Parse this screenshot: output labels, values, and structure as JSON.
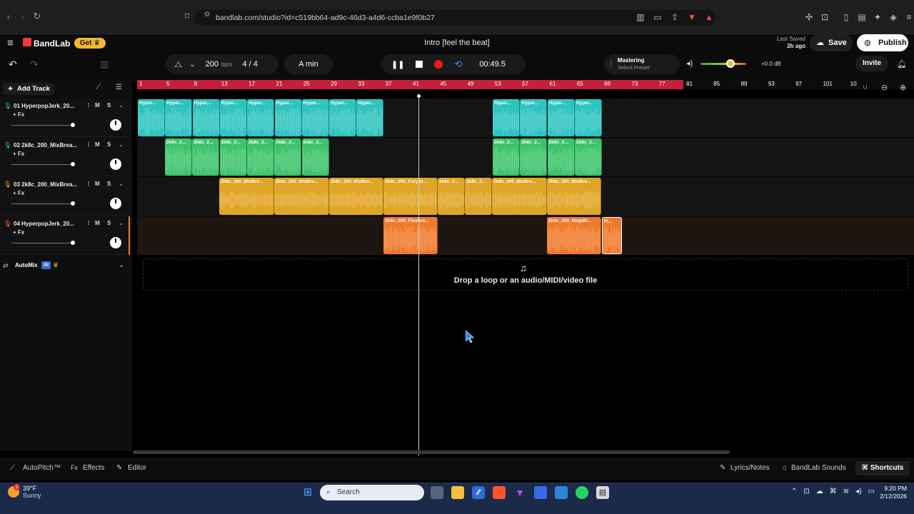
{
  "browser": {
    "url": "bandlab.com/studio?id=c519bb64-ad9c-46d3-a4d6-ccba1e9f0b27"
  },
  "header": {
    "logo": "BandLab",
    "get_label": "Get",
    "title": "Intro [feel the beat]",
    "last_saved_label": "Last Saved",
    "last_saved_value": "2h ago",
    "save_label": "Save",
    "publish_label": "Publish"
  },
  "toolbar": {
    "tempo": "200",
    "tempo_unit": "bpm",
    "time_signature": "4 / 4",
    "key": "A min",
    "time": "00:49.5",
    "mastering_label": "Mastering",
    "mastering_preset": "Select Preset",
    "volume_db": "+0.0 dB",
    "invite_label": "Invite"
  },
  "tracks_panel": {
    "add_track_label": "Add Track",
    "automix_label": "AutoMix",
    "ai_badge": "AI",
    "tracks": [
      {
        "name": "01  HyperpopJerk_20...",
        "fx": "+ Fx",
        "m": "M",
        "s": "S",
        "color": "#2ec4c0"
      },
      {
        "name": "02  2k8c_200_MixBrea...",
        "fx": "+ Fx",
        "m": "M",
        "s": "S",
        "color": "#3dc46a"
      },
      {
        "name": "03  2k8c_200_MixBrea...",
        "fx": "+ Fx",
        "m": "M",
        "s": "S",
        "color": "#e0a526"
      },
      {
        "name": "04  HyperpopJerk_20...",
        "fx": "+ Fx",
        "m": "M",
        "s": "S",
        "color": "#f07a2a"
      }
    ]
  },
  "ruler": {
    "ticks": [
      "1",
      "5",
      "9",
      "13",
      "17",
      "21",
      "25",
      "29",
      "33",
      "37",
      "41",
      "45",
      "49",
      "53",
      "57",
      "61",
      "65",
      "69",
      "73",
      "77",
      "81",
      "85",
      "89",
      "93",
      "97",
      "101",
      "10"
    ]
  },
  "lanes": {
    "clip_labels": {
      "hyper": "Hyper...",
      "k2c": "2k8c_2...",
      "mix": "2k8c_200_MixBre...",
      "fury": "2k8c_200_FuryBr...",
      "flex": "2k8c_200_FlexBre...",
      "ninja": "2k8c_200_NinjaBr...",
      "fl": "Fl..."
    }
  },
  "drop_zone": {
    "text": "Drop a loop or an audio/MIDI/video file"
  },
  "bottom_bar": {
    "autopitch": "AutoPitch™",
    "effects": "Effects",
    "editor": "Editor",
    "lyrics": "Lyrics/Notes",
    "sounds": "BandLab Sounds",
    "shortcuts": "Shortcuts"
  },
  "taskbar": {
    "weather_temp": "39°F",
    "weather_desc": "Sunny",
    "weather_badge": "2",
    "search_label": "Search",
    "time": "9:20 PM",
    "date": "2/12/2026"
  }
}
